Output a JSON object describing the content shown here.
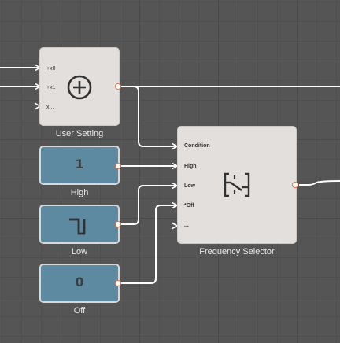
{
  "nodes": {
    "user_setting": {
      "caption": "User Setting",
      "ports": [
        "+x0",
        "+x1",
        "x..."
      ],
      "icon": "circled-plus-icon"
    },
    "high": {
      "caption": "High",
      "value": "1"
    },
    "low": {
      "caption": "Low",
      "icon": "square-wave-icon"
    },
    "off": {
      "caption": "Off",
      "value": "0"
    },
    "frequency_selector": {
      "caption": "Frequency Selector",
      "ports": [
        "Condition",
        "High",
        "Low",
        "*Off",
        "..."
      ],
      "icon": "switch-icon"
    }
  },
  "colors": {
    "canvas": "#555555",
    "node_light": "#e3dfdc",
    "node_value": "#5d8aa0",
    "wire": "#ffffff",
    "output_port": "#e0764e"
  }
}
